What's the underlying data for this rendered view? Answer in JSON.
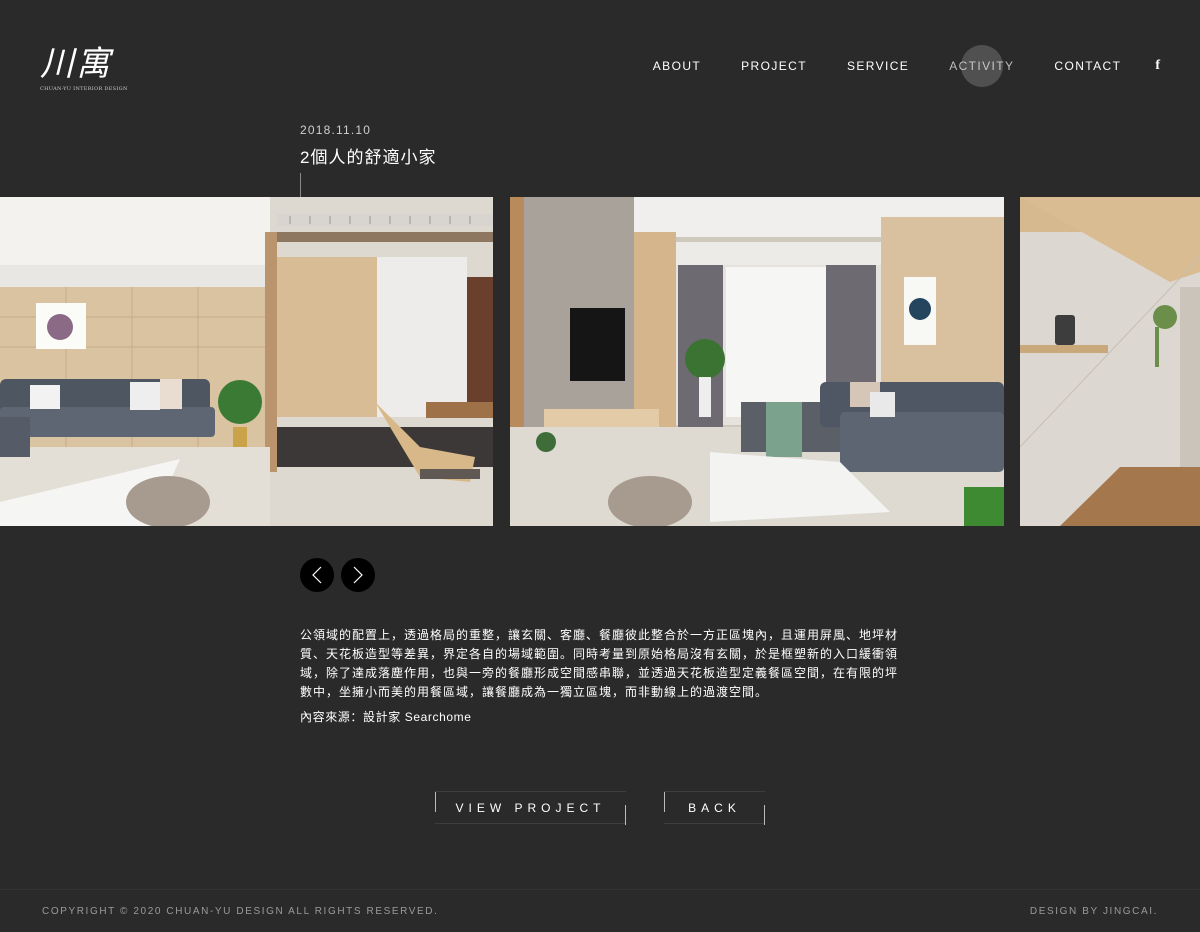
{
  "brand": {
    "logo_text": "川寓",
    "tagline": "CHUAN-YU INTERIOR DESIGN"
  },
  "nav": {
    "items": [
      "ABOUT",
      "PROJECT",
      "SERVICE",
      "ACTIVITY",
      "CONTACT"
    ],
    "active": "ACTIVITY",
    "social_icon": "facebook-icon",
    "social_glyph": "f"
  },
  "post": {
    "date": "2018.11.10",
    "title": "2個人的舒適小家",
    "body": "公領域的配置上，透過格局的重整，讓玄關、客廳、餐廳彼此整合於一方正區塊內，且運用屏風、地坪材質、天花板造型等差異，界定各自的場域範圍。同時考量到原始格局沒有玄關，於是框塑新的入口緩衝領域，除了達成落塵作用，也與一旁的餐廳形成空間感串聯，並透過天花板造型定義餐區空間，在有限的坪數中，坐擁小而美的用餐區域，讓餐廳成為一獨立區塊，而非動線上的過渡空間。",
    "source": "內容來源：設計家 Searchome"
  },
  "gallery": {
    "prev_icon": "chevron-left-icon",
    "next_icon": "chevron-right-icon"
  },
  "actions": {
    "view_project": "VIEW PROJECT",
    "back": "BACK"
  },
  "footer": {
    "copyright": "COPYRIGHT © 2020 CHUAN-YU DESIGN ALL RIGHTS RESERVED.",
    "credit": "DESIGN BY JINGCAI."
  },
  "colors": {
    "background": "#2a2a2a",
    "text": "#ffffff",
    "muted": "#9a9a9a",
    "arrow_bg": "#000000"
  }
}
